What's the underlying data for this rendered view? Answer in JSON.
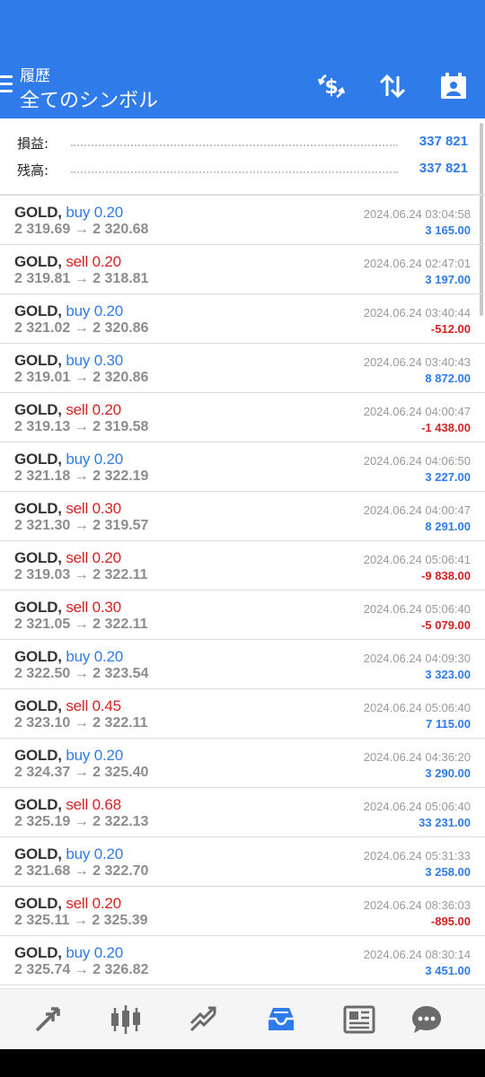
{
  "header": {
    "subtitle": "履歴",
    "title": "全てのシンボル"
  },
  "summary": {
    "profit_label": "損益:",
    "profit_value": "337 821",
    "balance_label": "残高:",
    "balance_value": "337 821"
  },
  "trades": [
    {
      "symbol": "GOLD,",
      "side": "buy",
      "volume": "0.20",
      "prices": "2 319.69 → 2 320.68",
      "time": "2024.06.24 03:04:58",
      "profit": "3 165.00",
      "negative": false
    },
    {
      "symbol": "GOLD,",
      "side": "sell",
      "volume": "0.20",
      "prices": "2 319.81 → 2 318.81",
      "time": "2024.06.24 02:47:01",
      "profit": "3 197.00",
      "negative": false
    },
    {
      "symbol": "GOLD,",
      "side": "buy",
      "volume": "0.20",
      "prices": "2 321.02 → 2 320.86",
      "time": "2024.06.24 03:40:44",
      "profit": "-512.00",
      "negative": true
    },
    {
      "symbol": "GOLD,",
      "side": "buy",
      "volume": "0.30",
      "prices": "2 319.01 → 2 320.86",
      "time": "2024.06.24 03:40:43",
      "profit": "8 872.00",
      "negative": false
    },
    {
      "symbol": "GOLD,",
      "side": "sell",
      "volume": "0.20",
      "prices": "2 319.13 → 2 319.58",
      "time": "2024.06.24 04:00:47",
      "profit": "-1 438.00",
      "negative": true
    },
    {
      "symbol": "GOLD,",
      "side": "buy",
      "volume": "0.20",
      "prices": "2 321.18 → 2 322.19",
      "time": "2024.06.24 04:06:50",
      "profit": "3 227.00",
      "negative": false
    },
    {
      "symbol": "GOLD,",
      "side": "sell",
      "volume": "0.30",
      "prices": "2 321.30 → 2 319.57",
      "time": "2024.06.24 04:00:47",
      "profit": "8 291.00",
      "negative": false
    },
    {
      "symbol": "GOLD,",
      "side": "sell",
      "volume": "0.20",
      "prices": "2 319.03 → 2 322.11",
      "time": "2024.06.24 05:06:41",
      "profit": "-9 838.00",
      "negative": true
    },
    {
      "symbol": "GOLD,",
      "side": "sell",
      "volume": "0.30",
      "prices": "2 321.05 → 2 322.11",
      "time": "2024.06.24 05:06:40",
      "profit": "-5 079.00",
      "negative": true
    },
    {
      "symbol": "GOLD,",
      "side": "buy",
      "volume": "0.20",
      "prices": "2 322.50 → 2 323.54",
      "time": "2024.06.24 04:09:30",
      "profit": "3 323.00",
      "negative": false
    },
    {
      "symbol": "GOLD,",
      "side": "sell",
      "volume": "0.45",
      "prices": "2 323.10 → 2 322.11",
      "time": "2024.06.24 05:06:40",
      "profit": "7 115.00",
      "negative": false
    },
    {
      "symbol": "GOLD,",
      "side": "buy",
      "volume": "0.20",
      "prices": "2 324.37 → 2 325.40",
      "time": "2024.06.24 04:36:20",
      "profit": "3 290.00",
      "negative": false
    },
    {
      "symbol": "GOLD,",
      "side": "sell",
      "volume": "0.68",
      "prices": "2 325.19 → 2 322.13",
      "time": "2024.06.24 05:06:40",
      "profit": "33 231.00",
      "negative": false
    },
    {
      "symbol": "GOLD,",
      "side": "buy",
      "volume": "0.20",
      "prices": "2 321.68 → 2 322.70",
      "time": "2024.06.24 05:31:33",
      "profit": "3 258.00",
      "negative": false
    },
    {
      "symbol": "GOLD,",
      "side": "sell",
      "volume": "0.20",
      "prices": "2 325.11 → 2 325.39",
      "time": "2024.06.24 08:36:03",
      "profit": "-895.00",
      "negative": true
    },
    {
      "symbol": "GOLD,",
      "side": "buy",
      "volume": "0.20",
      "prices": "2 325.74 → 2 326.82",
      "time": "2024.06.24 08:30:14",
      "profit": "3 451.00",
      "negative": false
    }
  ],
  "nav": {
    "items": [
      "quotes-icon",
      "chart-candles-icon",
      "trade-icon",
      "history-inbox-icon",
      "news-icon",
      "chat-icon"
    ],
    "active_index": 3
  },
  "colors": {
    "accent": "#2f7be9",
    "negative": "#d32222",
    "muted": "#8c8c8c"
  }
}
